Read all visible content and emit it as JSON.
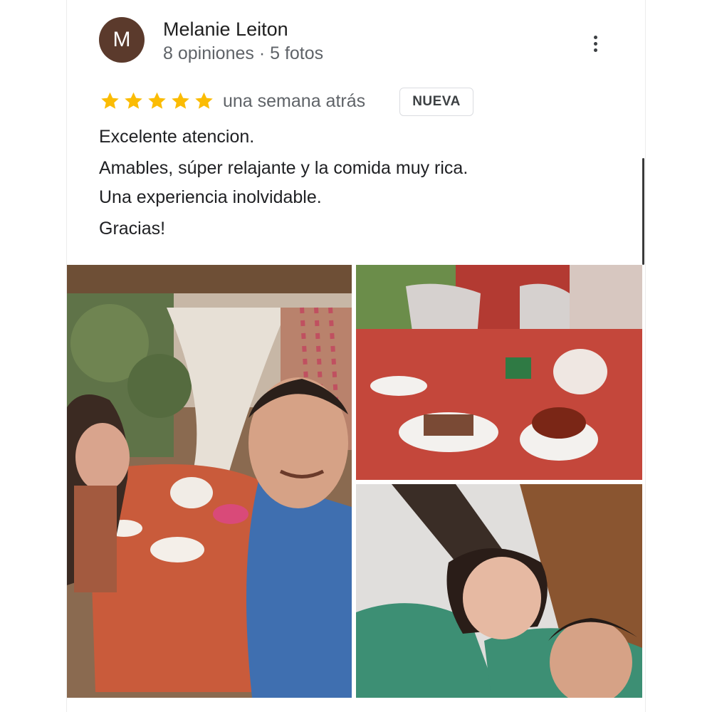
{
  "reviewer": {
    "initial": "M",
    "name": "Melanie Leiton",
    "meta": "8 opiniones · 5 fotos",
    "avatar_color": "#5b3a2c"
  },
  "review": {
    "rating": 5,
    "max_rating": 5,
    "star_color": "#fbbc04",
    "date": "una semana atrás",
    "badge": "NUEVA",
    "lines": [
      "Excelente atencion.",
      "Amables, súper relajante y la comida muy rica.",
      "Una experiencia inolvidable.",
      "Gracias!"
    ]
  },
  "icons": {
    "more": "more-vert-icon",
    "star": "star-icon"
  }
}
